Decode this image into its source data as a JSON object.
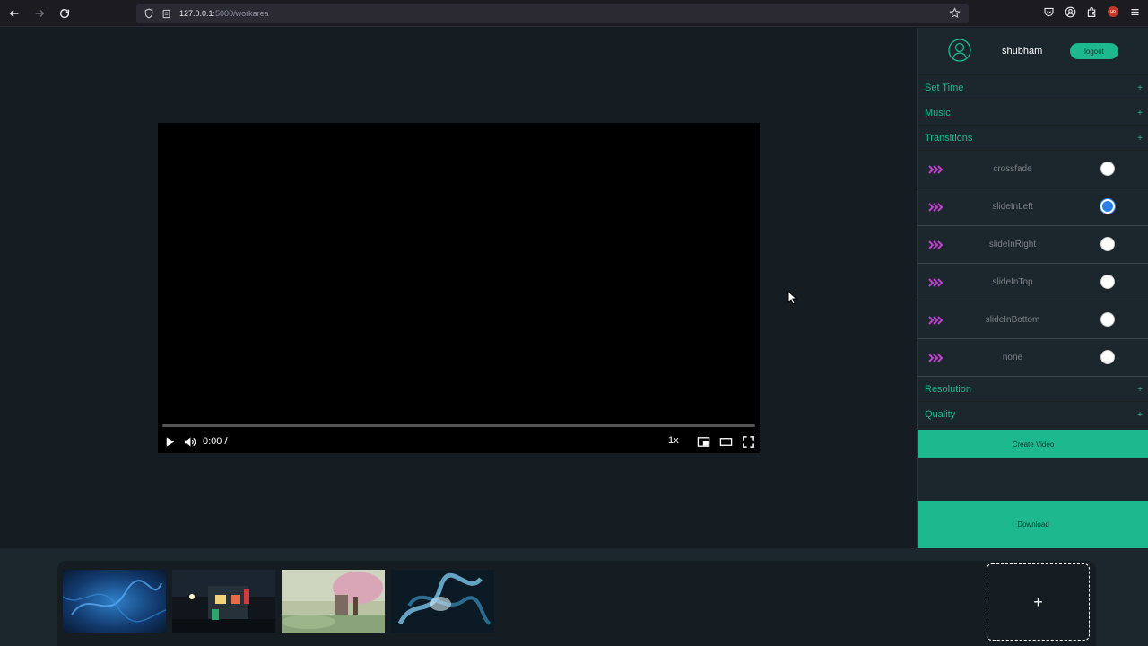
{
  "browser": {
    "url_host": "127.0.0.1",
    "url_path": ":5000/workarea",
    "icons": [
      "back-icon",
      "forward-icon",
      "reload-icon",
      "shield-icon",
      "page-icon",
      "star-icon",
      "pocket-icon",
      "account-icon",
      "extensions-icon",
      "ublock-icon",
      "menu-icon"
    ],
    "ublock_badge": "uo"
  },
  "video": {
    "time": "0:00 /",
    "speed": "1x",
    "progress": 0
  },
  "panel": {
    "username": "shubham",
    "logout_label": "logout",
    "sections": {
      "set_time": "Set Time",
      "music": "Music",
      "transitions": "Transitions",
      "resolution": "Resolution",
      "quality": "Quality"
    },
    "expand_symbol": "+",
    "transitions": [
      {
        "label": "crossfade",
        "selected": false
      },
      {
        "label": "slideInLeft",
        "selected": true
      },
      {
        "label": "slideInRight",
        "selected": false
      },
      {
        "label": "slideInTop",
        "selected": false
      },
      {
        "label": "slideInBottom",
        "selected": false
      },
      {
        "label": "none",
        "selected": false
      }
    ],
    "create_label": "Create Video",
    "download_label": "Download"
  },
  "timeline": {
    "add_symbol": "+",
    "thumbnails": [
      {
        "name": "blue-abstract-thumbnail"
      },
      {
        "name": "night-street-thumbnail"
      },
      {
        "name": "cherry-blossom-thumbnail"
      },
      {
        "name": "blue-smoke-thumbnail"
      }
    ]
  },
  "colors": {
    "accent": "#1db88e",
    "panel_bg": "#1c272d",
    "work_bg": "#161d22",
    "radio_selected": "#2a7fe6",
    "transition_icon": "#c13fd1"
  }
}
